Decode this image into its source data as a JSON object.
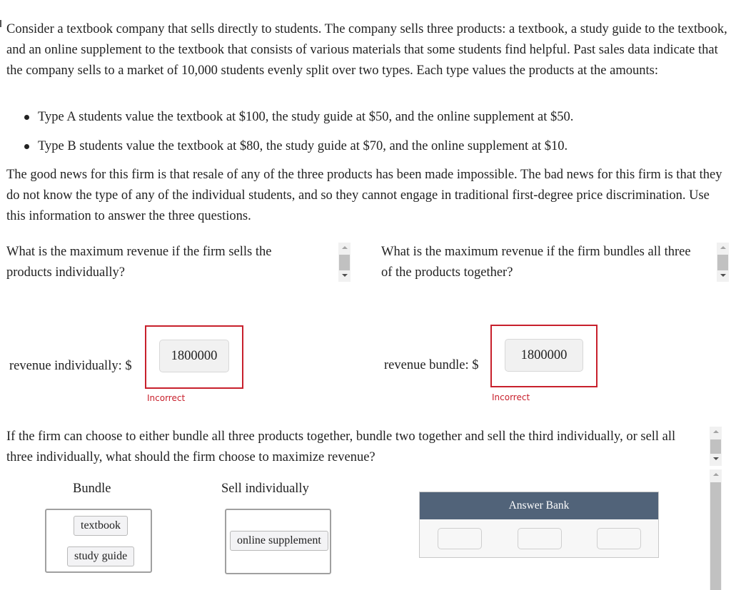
{
  "intro": "Consider a textbook company that sells directly to students. The company sells three products: a textbook, a study guide to the textbook, and an online supplement to the textbook that consists of various materials that some students find helpful. Past sales data indicate that the company sells to a market of 10,000 students evenly split over two types. Each type values the products at the amounts:",
  "bullets": [
    "Type A students value the textbook at $100, the study guide at $50, and the online supplement at $50.",
    "Type B students value the textbook at $80, the study guide at $70, and the online supplement at $10."
  ],
  "paragraph2": "The good news for this firm is that resale of any of the three products has been made impossible. The bad news for this firm is that they do not know the type of any of the individual students, and so they cannot engage in traditional first-degree price discrimination. Use this information to answer the three questions.",
  "question1": {
    "prompt": "What is the maximum revenue if the firm sells the products individually?",
    "label": "revenue individually: $",
    "value": "1800000",
    "feedback": "Incorrect"
  },
  "question2": {
    "prompt": "What is the maximum revenue if the firm bundles all three of the products together?",
    "label": "revenue bundle: $",
    "value": "1800000",
    "feedback": "Incorrect"
  },
  "question3": {
    "prompt": "If the firm can choose to either bundle all three products together, bundle two together and sell the third individually, or sell all three individually, what should the firm choose to maximize revenue?",
    "bundle_heading": "Bundle",
    "individual_heading": "Sell individually",
    "bundle_items": [
      "textbook",
      "study guide"
    ],
    "individual_items": [
      "online supplement"
    ],
    "answer_bank_title": "Answer Bank",
    "colors": {
      "bank_header": "#516379",
      "incorrect": "#c8202c"
    }
  }
}
